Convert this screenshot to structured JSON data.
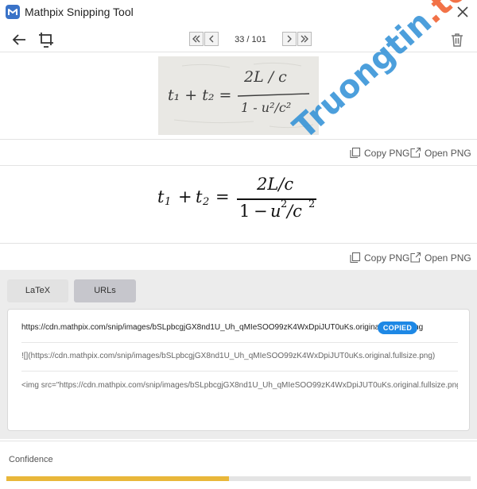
{
  "window": {
    "title": "Mathpix Snipping Tool",
    "logo_glyph": "M"
  },
  "toolbar": {
    "pager": "33 / 101"
  },
  "handwritten_snip": {
    "lhs": "t₁ + t₂ =",
    "numerator": "2L / c",
    "denominator": "1 - u²/c²"
  },
  "actions": {
    "copy_png": "Copy PNG",
    "open_png": "Open PNG"
  },
  "rendered_formula": {
    "t": "t",
    "sub1": "1",
    "plus": "+",
    "sub2": "2",
    "equals": "=",
    "num": "2L/c",
    "den_one": "1",
    "den_minus": "−",
    "den_u": "u",
    "sup2": "2",
    "den_slash_c": "/c"
  },
  "tabs": [
    {
      "label": "LaTeX",
      "active": false
    },
    {
      "label": "URLs",
      "active": true
    }
  ],
  "urls": [
    "https://cdn.mathpix.com/snip/images/bSLpbcgjGX8nd1U_Uh_qMIeSOO99zK4WxDpiJUT0uKs.original.fullsize.png",
    "![](https://cdn.mathpix.com/snip/images/bSLpbcgjGX8nd1U_Uh_qMIeSOO99zK4WxDpiJUT0uKs.original.fullsize.png)",
    "<img src=\"https://cdn.mathpix.com/snip/images/bSLpbcgjGX8nd1U_Uh_qMIeSOO99zK4WxDpiJUT0uKs.original.fullsize.png\" />"
  ],
  "copied_badge": "COPIED",
  "confidence": {
    "label": "Confidence",
    "fraction": 0.48
  },
  "watermark": {
    "brand": "Truongtin",
    "tld": ".top"
  },
  "colors": {
    "accent": "#1e88e5",
    "confidence_bar": "#e9b73a",
    "watermark_blue": "#2d8fd6",
    "watermark_orange": "#f05a28"
  }
}
